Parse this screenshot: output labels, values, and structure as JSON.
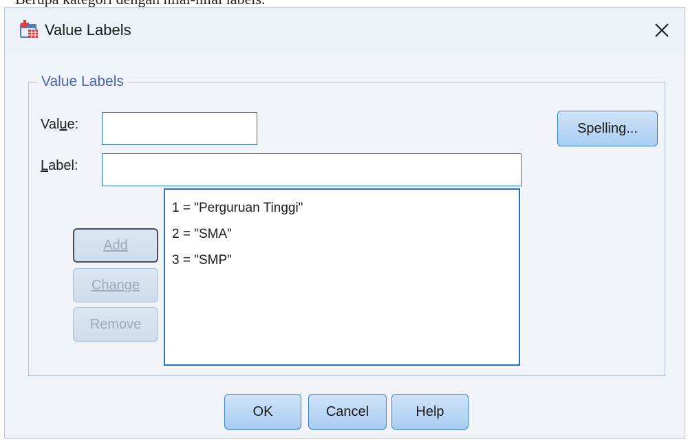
{
  "background_text": "Berupa kategori dengan nilai-nilai labels.",
  "window": {
    "title": "Value Labels",
    "close_icon": "close-icon",
    "app_icon": "spss-variable-icon"
  },
  "group": {
    "legend": "Value Labels"
  },
  "value_field": {
    "label_prefix": "Val",
    "label_mnemonic": "u",
    "label_suffix": "e:",
    "value": ""
  },
  "label_field": {
    "label_prefix": "",
    "label_mnemonic": "L",
    "label_suffix": "abel:",
    "value": ""
  },
  "buttons": {
    "spelling": "Spelling...",
    "add": "Add",
    "change": "Change",
    "remove": "Remove",
    "ok": "OK",
    "cancel": "Cancel",
    "help": "Help"
  },
  "value_labels_list": [
    "1 = \"Perguruan Tinggi\"",
    "2 = \"SMA\"",
    "3 = \"SMP\""
  ],
  "colors": {
    "legend": "#4a64ad",
    "accent_border": "#2e6fbf",
    "button_fill": "#a9cdf2",
    "dialog_bg": "#f0f4f9"
  }
}
